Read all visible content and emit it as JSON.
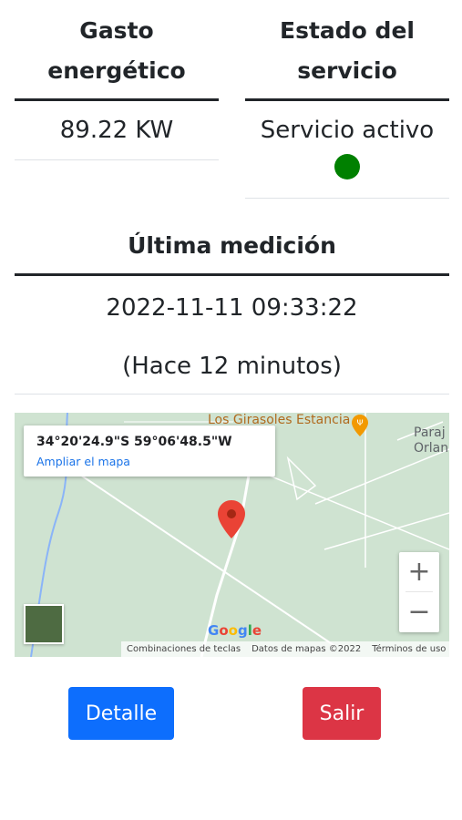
{
  "energy": {
    "header": "Gasto energético",
    "value": "89.22 KW"
  },
  "service": {
    "header": "Estado del servicio",
    "value": "Servicio activo",
    "status_color": "#008000"
  },
  "measurement": {
    "header": "Última medición",
    "datetime": "2022-11-11 09:33:22",
    "relative": "(Hace 12 minutos)"
  },
  "map": {
    "coordinates": "34°20'24.9\"S 59°06'48.5\"W",
    "enlarge_link": "Ampliar el mapa",
    "place_label": "Los Girasoles Estancia",
    "place_label_2a": "Paraj",
    "place_label_2b": "Orlan",
    "zoom_in": "+",
    "zoom_out": "−",
    "logo": "Google",
    "attribution": {
      "shortcuts": "Combinaciones de teclas",
      "data": "Datos de mapas ©2022",
      "terms": "Términos de uso"
    },
    "marker_color": "#ea4335"
  },
  "actions": {
    "detail": "Detalle",
    "exit": "Salir",
    "detail_color": "#0d6efd",
    "exit_color": "#dc3545"
  }
}
